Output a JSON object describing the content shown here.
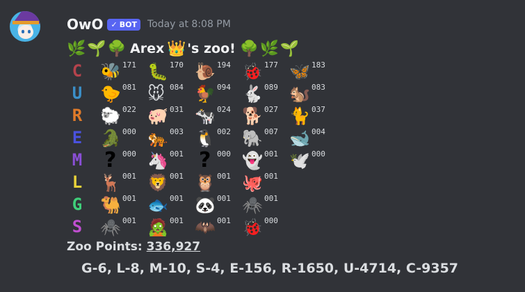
{
  "message": {
    "username": "OwO",
    "bot_badge": "BOT",
    "timestamp": "Today at 8:08 PM"
  },
  "title": {
    "leading_icons": [
      "🌿",
      "🌱",
      "🌳"
    ],
    "user": "Arex",
    "crown": "👑",
    "suffix": "'s zoo!",
    "trailing_icons": [
      "🌳",
      "🌿",
      "🌱"
    ]
  },
  "rows": [
    {
      "rank": "C",
      "color": "#b5434c",
      "animals": [
        {
          "icon": "🐝",
          "count": "171"
        },
        {
          "icon": "🐛",
          "count": "170"
        },
        {
          "icon": "🐌",
          "count": "194"
        },
        {
          "icon": "🐞",
          "count": "177"
        },
        {
          "icon": "🦋",
          "count": "183"
        }
      ]
    },
    {
      "rank": "U",
      "color": "#3b8fc8",
      "animals": [
        {
          "icon": "🐤",
          "count": "081"
        },
        {
          "icon": "🐭",
          "count": "084"
        },
        {
          "icon": "🐓",
          "count": "094"
        },
        {
          "icon": "🐇",
          "count": "089"
        },
        {
          "icon": "🐿️",
          "count": "083"
        }
      ]
    },
    {
      "rank": "R",
      "color": "#e07b2a",
      "animals": [
        {
          "icon": "🐑",
          "count": "022"
        },
        {
          "icon": "🐖",
          "count": "031"
        },
        {
          "icon": "🐄",
          "count": "024"
        },
        {
          "icon": "🐕",
          "count": "027"
        },
        {
          "icon": "🐈",
          "count": "037"
        }
      ]
    },
    {
      "rank": "E",
      "color": "#4a52e0",
      "animals": [
        {
          "icon": "🐊",
          "count": "000"
        },
        {
          "icon": "🐅",
          "count": "003"
        },
        {
          "icon": "🐧",
          "count": "002"
        },
        {
          "icon": "🐘",
          "count": "007"
        },
        {
          "icon": "🐋",
          "count": "004"
        }
      ]
    },
    {
      "rank": "M",
      "color": "#8a4fd6",
      "animals": [
        {
          "icon": "?",
          "count": "000"
        },
        {
          "icon": "🦄",
          "count": "001"
        },
        {
          "icon": "?",
          "count": "000"
        },
        {
          "icon": "👻",
          "count": "001"
        },
        {
          "icon": "🕊️",
          "count": "000"
        }
      ]
    },
    {
      "rank": "L",
      "color": "#e8d23a",
      "animals": [
        {
          "icon": "🦌",
          "count": "001"
        },
        {
          "icon": "🦁",
          "count": "001"
        },
        {
          "icon": "🦉",
          "count": "001"
        },
        {
          "icon": "🐙",
          "count": "001"
        }
      ]
    },
    {
      "rank": "G",
      "color": "#3fcf7a",
      "animals": [
        {
          "icon": "🐫",
          "count": "001"
        },
        {
          "icon": "🐟",
          "count": "001"
        },
        {
          "icon": "🐼",
          "count": "001"
        },
        {
          "icon": "🕷️",
          "count": "001"
        }
      ]
    },
    {
      "rank": "S",
      "color": "#c04fd0",
      "animals": [
        {
          "icon": "🕷️",
          "count": "001"
        },
        {
          "icon": "🧟",
          "count": "001"
        },
        {
          "icon": "🦇",
          "count": "001"
        },
        {
          "icon": "🐞",
          "count": "000"
        }
      ]
    }
  ],
  "points": {
    "label": "Zoo Points: ",
    "value": "336,927"
  },
  "summary": "G-6, L-8, M-10, S-4, E-156, R-1650, U-4714, C-9357"
}
